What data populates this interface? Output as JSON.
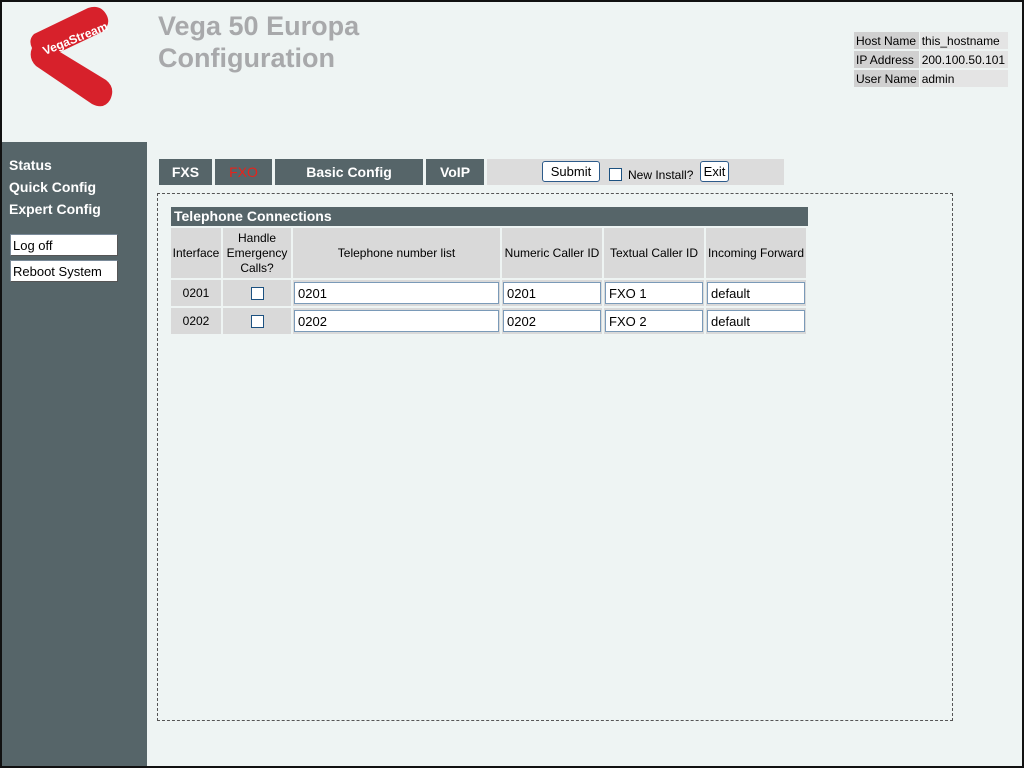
{
  "header": {
    "logo_text": "VegaStream",
    "title_line1": "Vega 50 Europa",
    "title_line2": "Configuration",
    "host": [
      {
        "key": "Host Name",
        "value": "this_hostname"
      },
      {
        "key": "IP Address",
        "value": "200.100.50.101"
      },
      {
        "key": "User Name",
        "value": "admin"
      }
    ]
  },
  "sidebar": {
    "links": [
      "Status",
      "Quick Config",
      "Expert Config"
    ],
    "logoff": "Log off",
    "reboot": "Reboot System"
  },
  "tabs": {
    "items": [
      {
        "label": "FXS",
        "active": false
      },
      {
        "label": "FXO",
        "active": true
      },
      {
        "label": "Basic Config",
        "active": false
      },
      {
        "label": "VoIP",
        "active": false
      }
    ],
    "submit": "Submit",
    "new_install": "New Install?",
    "exit": "Exit"
  },
  "section": {
    "title": "Telephone Connections",
    "columns": [
      "Interface",
      "Handle Emergency Calls?",
      "Telephone number list",
      "Numeric Caller ID",
      "Textual Caller ID",
      "Incoming Forward"
    ],
    "rows": [
      {
        "interface": "0201",
        "emergency": false,
        "numbers": "0201",
        "numeric_id": "0201",
        "textual_id": "FXO 1",
        "forward": "default"
      },
      {
        "interface": "0202",
        "emergency": false,
        "numbers": "0202",
        "numeric_id": "0202",
        "textual_id": "FXO 2",
        "forward": "default"
      }
    ]
  },
  "colors": {
    "sidebar": "#566569",
    "title": "#a8a9ab",
    "logo_red": "#d7212b",
    "active_tab": "#e8221a",
    "background": "#eef4f3"
  }
}
